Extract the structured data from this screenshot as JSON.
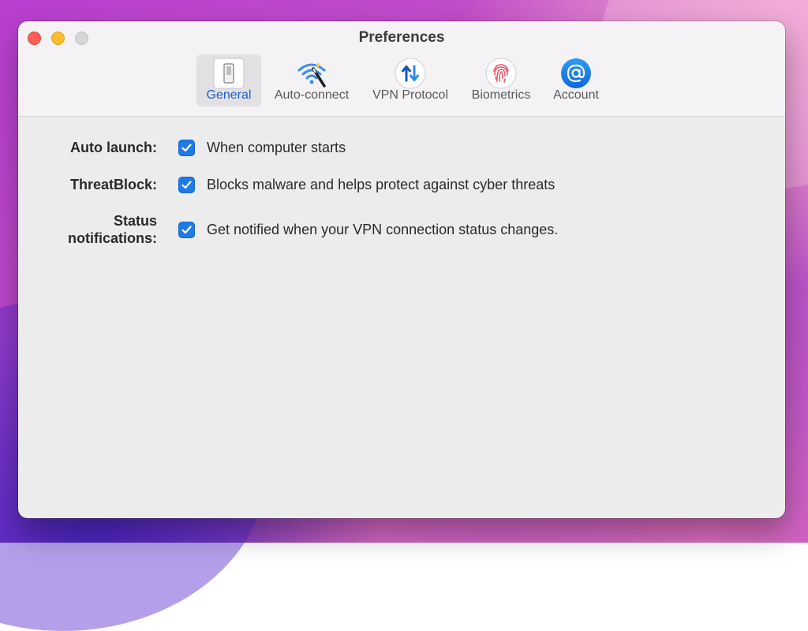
{
  "window": {
    "title": "Preferences"
  },
  "tabs": [
    {
      "id": "general",
      "label": "General",
      "icon": "switch-icon",
      "active": true
    },
    {
      "id": "auto-connect",
      "label": "Auto-connect",
      "icon": "wifi-wand-icon",
      "active": false
    },
    {
      "id": "vpn-protocol",
      "label": "VPN Protocol",
      "icon": "up-down-arrows-icon",
      "active": false
    },
    {
      "id": "biometrics",
      "label": "Biometrics",
      "icon": "fingerprint-icon",
      "active": false
    },
    {
      "id": "account",
      "label": "Account",
      "icon": "at-sign-icon",
      "active": false
    }
  ],
  "settings": [
    {
      "label": "Auto launch:",
      "description": "When computer starts",
      "checked": true
    },
    {
      "label": "ThreatBlock:",
      "description": "Blocks malware and helps protect against cyber threats",
      "checked": true
    },
    {
      "label_line1": "Status",
      "label_line2": "notifications:",
      "description": "Get notified when your VPN connection status changes.",
      "checked": true
    }
  ],
  "colors": {
    "accent": "#1f7ae8",
    "active_tab_label": "#1e5fc8",
    "close": "#fe5f57",
    "minimize": "#febc2e",
    "zoom_inactive": "#d7d5d7"
  }
}
